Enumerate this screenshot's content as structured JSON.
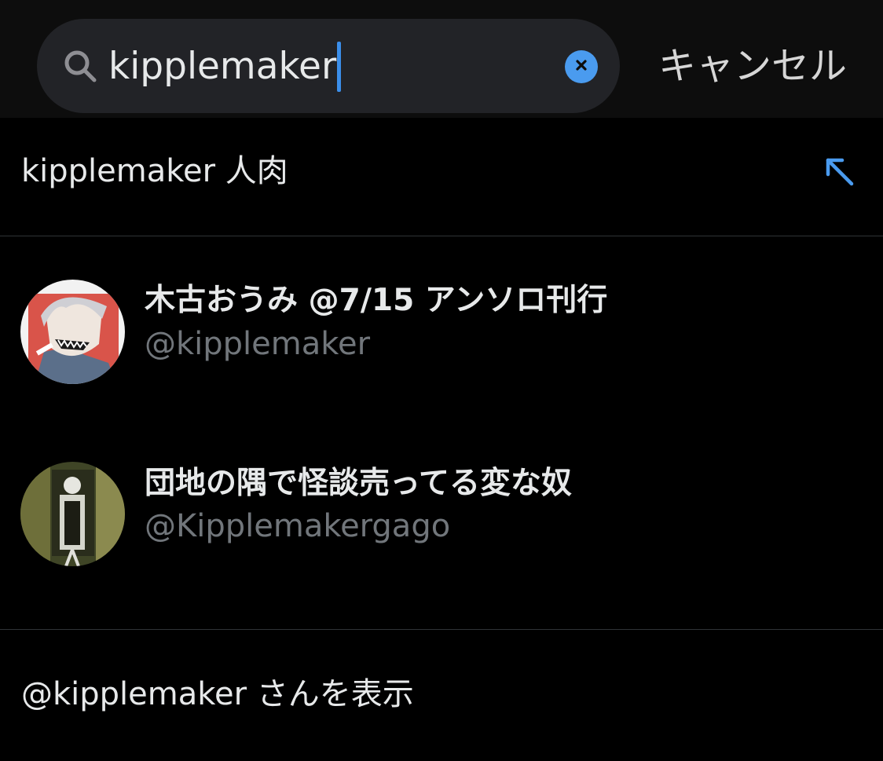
{
  "search": {
    "value": "kipplemaker",
    "cancel_label": "キャンセル"
  },
  "suggestion": {
    "text": "kipplemaker 人肉"
  },
  "users": [
    {
      "name": "木古おうみ @7/15 アンソロ刊行",
      "handle": "@kipplemaker"
    },
    {
      "name": "団地の隅で怪談売ってる変な奴",
      "handle": "@Kipplemakergago"
    }
  ],
  "go_to_user": {
    "label": "@kipplemaker さんを表示"
  },
  "colors": {
    "background": "#000000",
    "top_bar": "#0d0d0d",
    "search_field": "#222327",
    "accent": "#4a9bef",
    "primary_text": "#e7e9ea",
    "secondary_text": "#71767b",
    "divider": "#2f3336"
  },
  "icons": {
    "search": "search-icon",
    "clear": "clear-icon",
    "fill_query": "arrow-up-left-icon"
  }
}
